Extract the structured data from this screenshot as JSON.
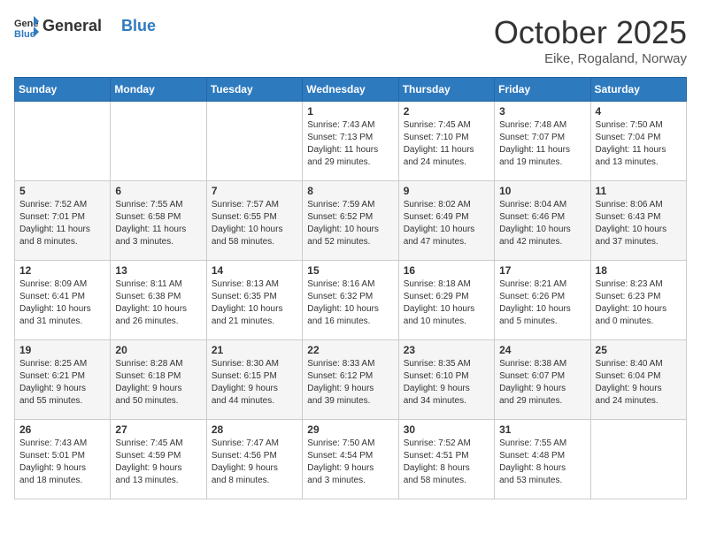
{
  "header": {
    "logo_general": "General",
    "logo_blue": "Blue",
    "month": "October 2025",
    "location": "Eike, Rogaland, Norway"
  },
  "days_of_week": [
    "Sunday",
    "Monday",
    "Tuesday",
    "Wednesday",
    "Thursday",
    "Friday",
    "Saturday"
  ],
  "weeks": [
    [
      {
        "day": "",
        "info": ""
      },
      {
        "day": "",
        "info": ""
      },
      {
        "day": "",
        "info": ""
      },
      {
        "day": "1",
        "info": "Sunrise: 7:43 AM\nSunset: 7:13 PM\nDaylight: 11 hours\nand 29 minutes."
      },
      {
        "day": "2",
        "info": "Sunrise: 7:45 AM\nSunset: 7:10 PM\nDaylight: 11 hours\nand 24 minutes."
      },
      {
        "day": "3",
        "info": "Sunrise: 7:48 AM\nSunset: 7:07 PM\nDaylight: 11 hours\nand 19 minutes."
      },
      {
        "day": "4",
        "info": "Sunrise: 7:50 AM\nSunset: 7:04 PM\nDaylight: 11 hours\nand 13 minutes."
      }
    ],
    [
      {
        "day": "5",
        "info": "Sunrise: 7:52 AM\nSunset: 7:01 PM\nDaylight: 11 hours\nand 8 minutes."
      },
      {
        "day": "6",
        "info": "Sunrise: 7:55 AM\nSunset: 6:58 PM\nDaylight: 11 hours\nand 3 minutes."
      },
      {
        "day": "7",
        "info": "Sunrise: 7:57 AM\nSunset: 6:55 PM\nDaylight: 10 hours\nand 58 minutes."
      },
      {
        "day": "8",
        "info": "Sunrise: 7:59 AM\nSunset: 6:52 PM\nDaylight: 10 hours\nand 52 minutes."
      },
      {
        "day": "9",
        "info": "Sunrise: 8:02 AM\nSunset: 6:49 PM\nDaylight: 10 hours\nand 47 minutes."
      },
      {
        "day": "10",
        "info": "Sunrise: 8:04 AM\nSunset: 6:46 PM\nDaylight: 10 hours\nand 42 minutes."
      },
      {
        "day": "11",
        "info": "Sunrise: 8:06 AM\nSunset: 6:43 PM\nDaylight: 10 hours\nand 37 minutes."
      }
    ],
    [
      {
        "day": "12",
        "info": "Sunrise: 8:09 AM\nSunset: 6:41 PM\nDaylight: 10 hours\nand 31 minutes."
      },
      {
        "day": "13",
        "info": "Sunrise: 8:11 AM\nSunset: 6:38 PM\nDaylight: 10 hours\nand 26 minutes."
      },
      {
        "day": "14",
        "info": "Sunrise: 8:13 AM\nSunset: 6:35 PM\nDaylight: 10 hours\nand 21 minutes."
      },
      {
        "day": "15",
        "info": "Sunrise: 8:16 AM\nSunset: 6:32 PM\nDaylight: 10 hours\nand 16 minutes."
      },
      {
        "day": "16",
        "info": "Sunrise: 8:18 AM\nSunset: 6:29 PM\nDaylight: 10 hours\nand 10 minutes."
      },
      {
        "day": "17",
        "info": "Sunrise: 8:21 AM\nSunset: 6:26 PM\nDaylight: 10 hours\nand 5 minutes."
      },
      {
        "day": "18",
        "info": "Sunrise: 8:23 AM\nSunset: 6:23 PM\nDaylight: 10 hours\nand 0 minutes."
      }
    ],
    [
      {
        "day": "19",
        "info": "Sunrise: 8:25 AM\nSunset: 6:21 PM\nDaylight: 9 hours\nand 55 minutes."
      },
      {
        "day": "20",
        "info": "Sunrise: 8:28 AM\nSunset: 6:18 PM\nDaylight: 9 hours\nand 50 minutes."
      },
      {
        "day": "21",
        "info": "Sunrise: 8:30 AM\nSunset: 6:15 PM\nDaylight: 9 hours\nand 44 minutes."
      },
      {
        "day": "22",
        "info": "Sunrise: 8:33 AM\nSunset: 6:12 PM\nDaylight: 9 hours\nand 39 minutes."
      },
      {
        "day": "23",
        "info": "Sunrise: 8:35 AM\nSunset: 6:10 PM\nDaylight: 9 hours\nand 34 minutes."
      },
      {
        "day": "24",
        "info": "Sunrise: 8:38 AM\nSunset: 6:07 PM\nDaylight: 9 hours\nand 29 minutes."
      },
      {
        "day": "25",
        "info": "Sunrise: 8:40 AM\nSunset: 6:04 PM\nDaylight: 9 hours\nand 24 minutes."
      }
    ],
    [
      {
        "day": "26",
        "info": "Sunrise: 7:43 AM\nSunset: 5:01 PM\nDaylight: 9 hours\nand 18 minutes."
      },
      {
        "day": "27",
        "info": "Sunrise: 7:45 AM\nSunset: 4:59 PM\nDaylight: 9 hours\nand 13 minutes."
      },
      {
        "day": "28",
        "info": "Sunrise: 7:47 AM\nSunset: 4:56 PM\nDaylight: 9 hours\nand 8 minutes."
      },
      {
        "day": "29",
        "info": "Sunrise: 7:50 AM\nSunset: 4:54 PM\nDaylight: 9 hours\nand 3 minutes."
      },
      {
        "day": "30",
        "info": "Sunrise: 7:52 AM\nSunset: 4:51 PM\nDaylight: 8 hours\nand 58 minutes."
      },
      {
        "day": "31",
        "info": "Sunrise: 7:55 AM\nSunset: 4:48 PM\nDaylight: 8 hours\nand 53 minutes."
      },
      {
        "day": "",
        "info": ""
      }
    ]
  ]
}
